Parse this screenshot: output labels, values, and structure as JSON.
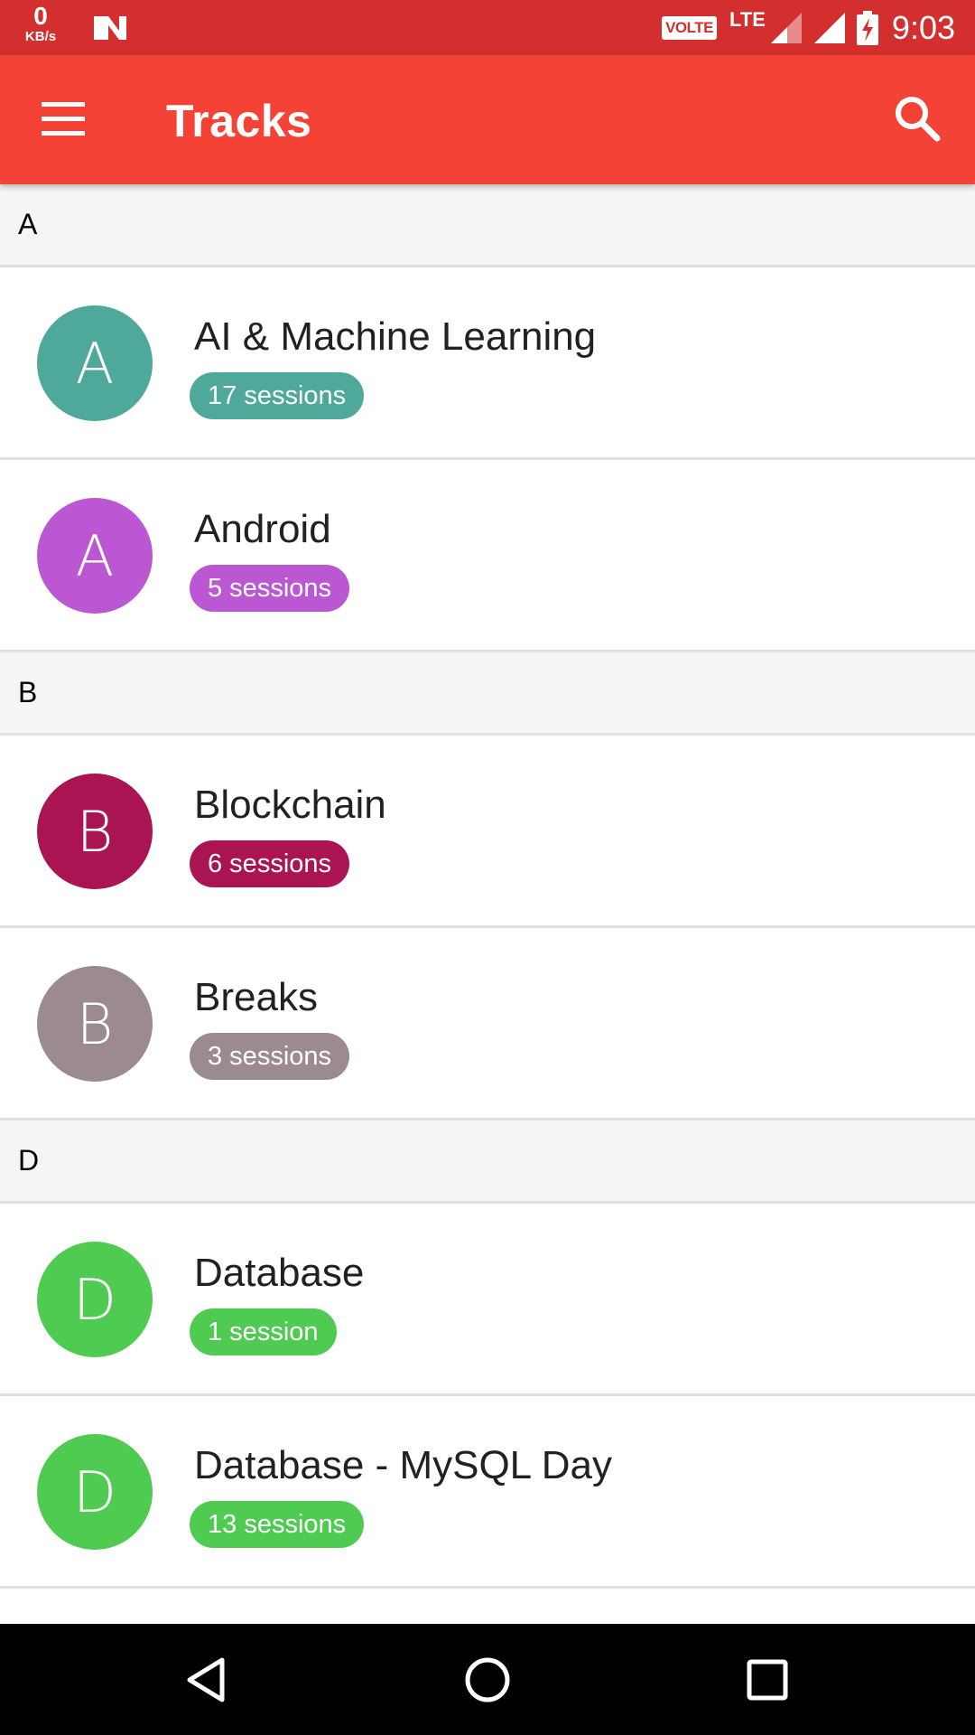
{
  "status_bar": {
    "net_speed_value": "0",
    "net_speed_unit": "KB/s",
    "volte": "VOLTE",
    "network_type": "LTE",
    "time": "9:03"
  },
  "app_bar": {
    "title": "Tracks",
    "menu_icon": "hamburger-menu-icon",
    "search_icon": "search-icon",
    "color": "#f44336",
    "status_color": "#d32f2f"
  },
  "sections": [
    {
      "letter": "A",
      "tracks": [
        {
          "initial": "A",
          "name": "AI & Machine Learning",
          "sessions": "17 sessions",
          "color": "#4fa99a"
        },
        {
          "initial": "A",
          "name": "Android",
          "sessions": "5 sessions",
          "color": "#bb57d3"
        }
      ]
    },
    {
      "letter": "B",
      "tracks": [
        {
          "initial": "B",
          "name": "Blockchain",
          "sessions": "6 sessions",
          "color": "#ab1452"
        },
        {
          "initial": "B",
          "name": "Breaks",
          "sessions": "3 sessions",
          "color": "#9b8a90"
        }
      ]
    },
    {
      "letter": "D",
      "tracks": [
        {
          "initial": "D",
          "name": "Database",
          "sessions": "1 session",
          "color": "#4ecb50"
        },
        {
          "initial": "D",
          "name": "Database - MySQL Day",
          "sessions": "13 sessions",
          "color": "#4ecb50"
        }
      ]
    }
  ],
  "nav_bar": {
    "back_icon": "back-triangle-icon",
    "home_icon": "home-circle-icon",
    "recents_icon": "recents-square-icon"
  }
}
